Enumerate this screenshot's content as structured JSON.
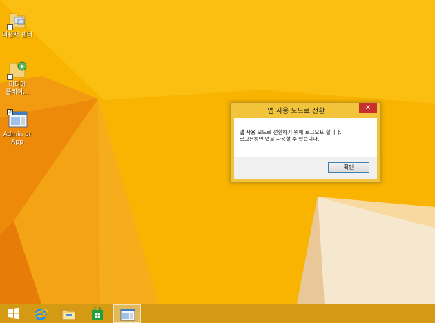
{
  "desktop": {
    "icons": [
      {
        "label": "미션저 센터",
        "icon": "sync-center-folder-icon"
      },
      {
        "label": "미디어\n플레이...",
        "icon": "media-player-folder-icon"
      },
      {
        "label": "Admin or\nApp",
        "icon": "admin-app-window-icon"
      }
    ]
  },
  "dialog": {
    "title": "앱 사용 모드로 전환",
    "close_glyph": "✕",
    "message_line1": "앱 사용 모드로 전환하기 위해 로그오프 합니다.",
    "message_line2": "로그온하면 앱을 사용할 수 있습니다.",
    "ok_label": "확인"
  },
  "taskbar": {
    "items": [
      {
        "icon": "windows-start-icon"
      },
      {
        "icon": "internet-explorer-icon"
      },
      {
        "icon": "file-explorer-icon"
      },
      {
        "icon": "store-icon"
      },
      {
        "icon": "app-window-icon",
        "active": true
      }
    ]
  },
  "colors": {
    "wallpaper": "#f7b000",
    "dialog_frame": "#f1c43c",
    "close_button": "#c7302c",
    "taskbar": "#d49a14"
  }
}
